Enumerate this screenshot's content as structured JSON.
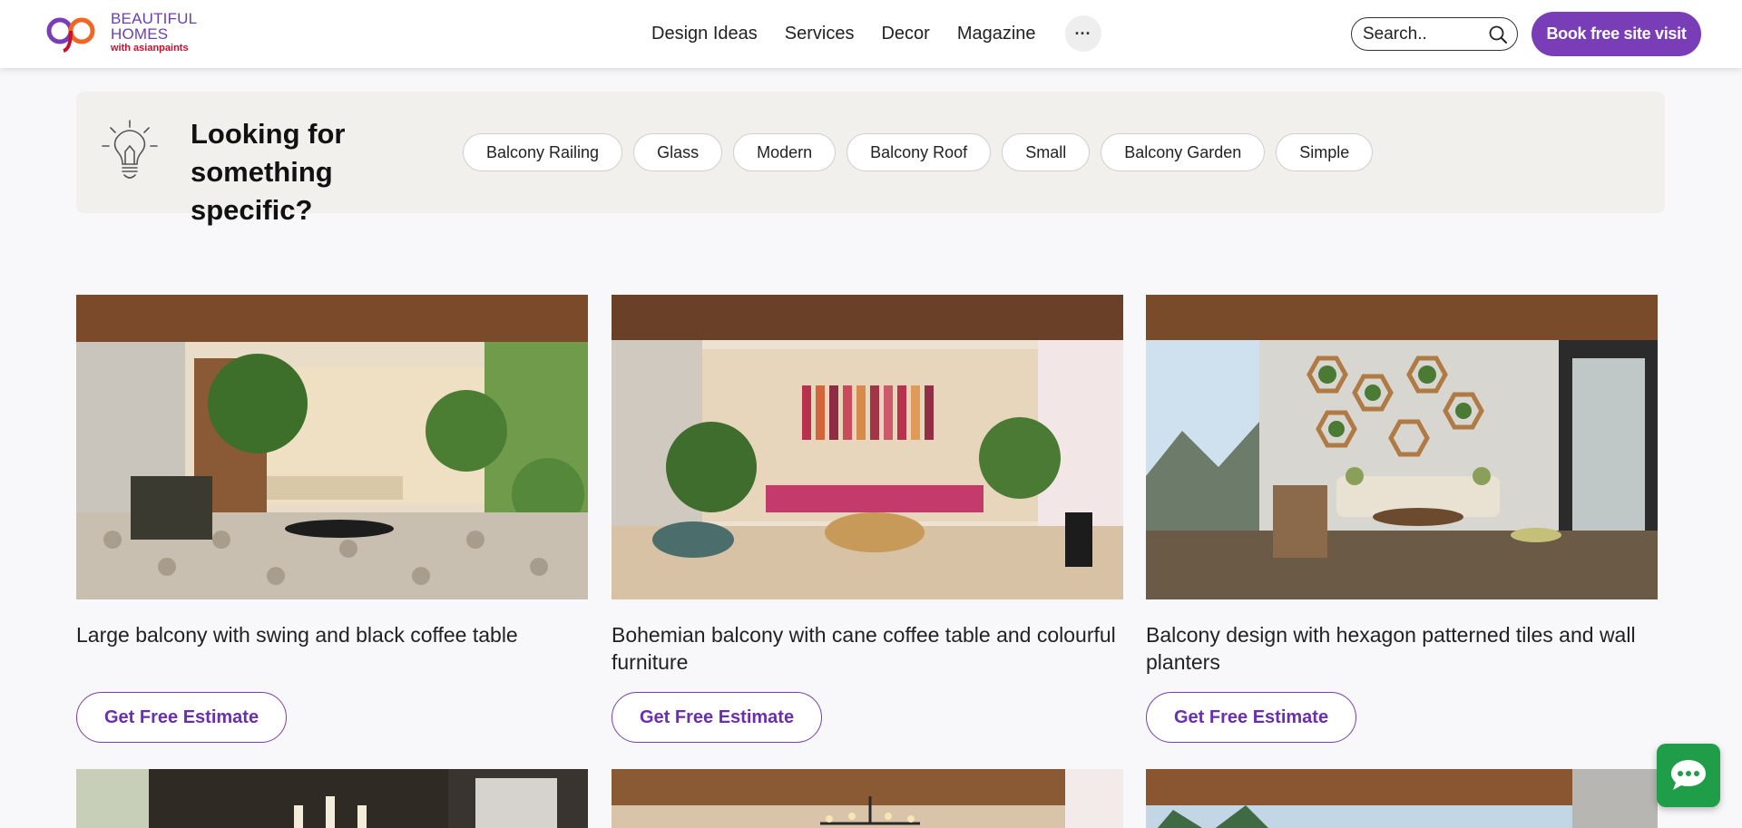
{
  "header": {
    "logo": {
      "line1": "BEAUTIFUL",
      "line2": "HOMES",
      "line3": "with asianpaints"
    },
    "nav": [
      "Design Ideas",
      "Services",
      "Decor",
      "Magazine"
    ],
    "more_label": "···",
    "search_placeholder": "Search..",
    "book_button": "Book free site visit"
  },
  "looking_for": {
    "title": "Looking for something specific?",
    "chips": [
      "Balcony Railing",
      "Glass",
      "Modern",
      "Balcony Roof",
      "Small",
      "Balcony Garden",
      "Simple"
    ]
  },
  "cards": [
    {
      "title": "Large balcony with swing and black coffee table",
      "button": "Get Free Estimate"
    },
    {
      "title": "Bohemian balcony with cane coffee table and colourful furniture",
      "button": "Get Free Estimate"
    },
    {
      "title": "Balcony design with hexagon patterned tiles and wall planters",
      "button": "Get Free Estimate"
    }
  ],
  "colors": {
    "brand_purple": "#7a3db8",
    "chat_green": "#1f9d49",
    "strip_bg": "#f1f0ed"
  },
  "icons": [
    "logo-mark",
    "more-dots-icon",
    "search-icon",
    "bulb-icon",
    "chat-icon"
  ]
}
